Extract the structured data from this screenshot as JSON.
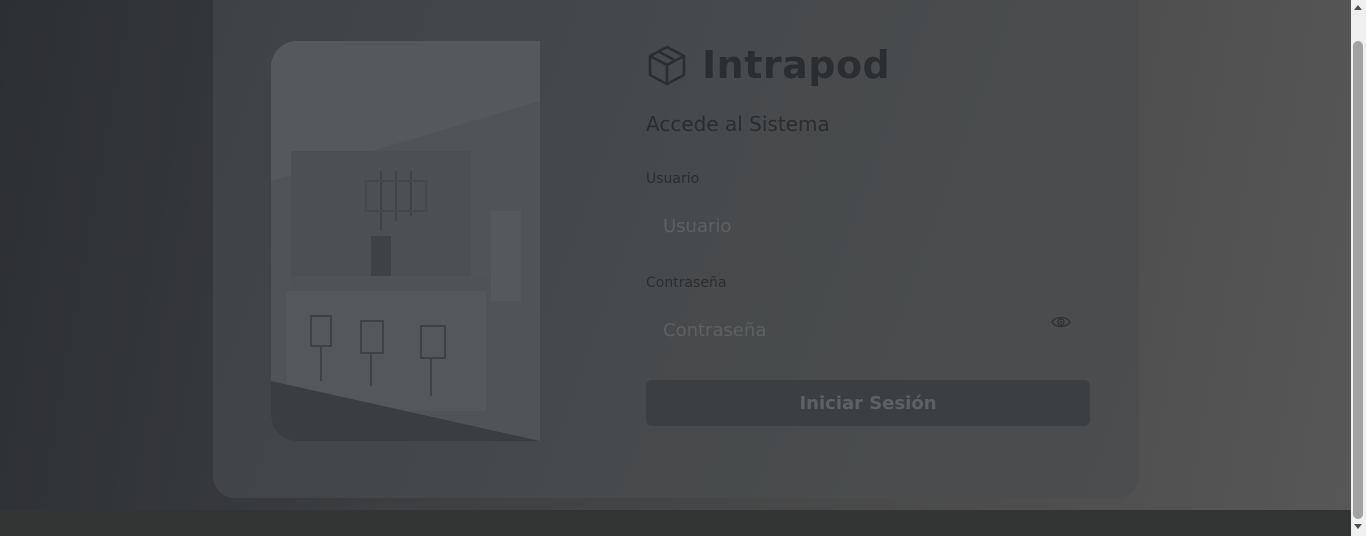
{
  "brand": {
    "name": "Intrapod",
    "icon": "cube-icon"
  },
  "login": {
    "subtitle": "Accede al Sistema",
    "username_label": "Usuario",
    "username_placeholder": "Usuario",
    "password_label": "Contraseña",
    "password_placeholder": "Contraseña",
    "submit_label": "Iniciar Sesión"
  },
  "colors": {
    "overlay_dark": "#2c2f33",
    "card": "#474a4c",
    "button": "#3c3f42",
    "scrollbar_track": "#f0f0f0",
    "scrollbar_thumb": "#a3a3a3"
  }
}
